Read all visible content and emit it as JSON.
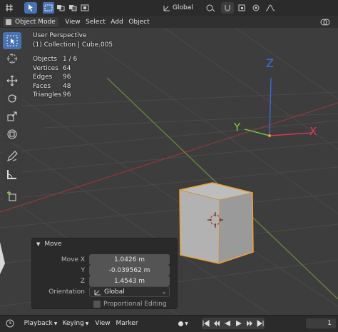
{
  "header": {
    "transform_orientation": "Global",
    "colors": {
      "bg": "#2b2b2b",
      "active": "#4772b3"
    }
  },
  "view_header": {
    "mode": "Object Mode",
    "menus": [
      "View",
      "Select",
      "Add",
      "Object"
    ]
  },
  "overlay": {
    "perspective": "User Perspective",
    "collection": "(1) Collection | Cube.005",
    "stats": [
      {
        "label": "Objects",
        "value": "1 / 6"
      },
      {
        "label": "Vertices",
        "value": "64"
      },
      {
        "label": "Edges",
        "value": "96"
      },
      {
        "label": "Faces",
        "value": "48"
      },
      {
        "label": "Triangles",
        "value": "96"
      }
    ]
  },
  "gizmo": {
    "x": "X",
    "y": "Y",
    "z": "Z",
    "colors": {
      "x": "#e8395a",
      "y": "#7fd23a",
      "z": "#3a6fe8"
    }
  },
  "move_panel": {
    "title": "Move",
    "move_x_label": "Move X",
    "move_x": "1.0426 m",
    "y_label": "Y",
    "move_y": "-0.039562 m",
    "z_label": "Z",
    "move_z": "1.4543 m",
    "orientation_label": "Orientation",
    "orientation": "Global",
    "proportional_editing": "Proportional Editing"
  },
  "timeline": {
    "menus": [
      "Playback",
      "Keying",
      "View",
      "Marker"
    ],
    "current_frame": "1"
  }
}
